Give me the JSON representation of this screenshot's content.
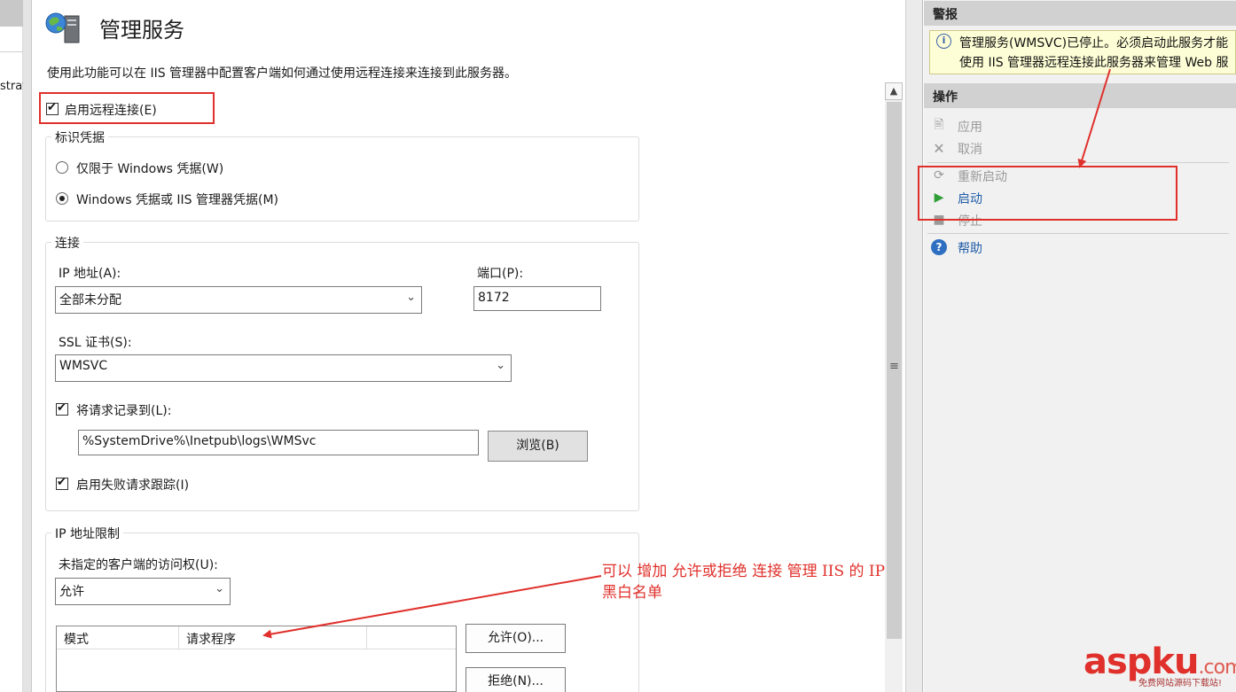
{
  "left_strip": {
    "text": "strat"
  },
  "page": {
    "title": "管理服务",
    "description": "使用此功能可以在 IIS 管理器中配置客户端如何通过使用远程连接来连接到此服务器。"
  },
  "remote": {
    "enable_label": "启用远程连接(E)",
    "checked": true
  },
  "identity": {
    "group_title": "标识凭据",
    "option_windows_only": "仅限于 Windows 凭据(W)",
    "option_windows_or_iis": "Windows 凭据或 IIS 管理器凭据(M)",
    "selected": "option_windows_or_iis"
  },
  "connection": {
    "group_title": "连接",
    "ip_label": "IP 地址(A):",
    "ip_value": "全部未分配",
    "port_label": "端口(P):",
    "port_value": "8172",
    "ssl_label": "SSL 证书(S):",
    "ssl_value": "WMSVC",
    "log_label": "将请求记录到(L):",
    "log_path": "%SystemDrive%\\Inetpub\\logs\\WMSvc",
    "browse_label": "浏览(B)",
    "failed_trace_label": "启用失败请求跟踪(I)"
  },
  "ip_restriction": {
    "group_title": "IP 地址限制",
    "access_label": "未指定的客户端的访问权(U):",
    "access_value": "允许",
    "columns": [
      "模式",
      "请求程序"
    ],
    "allow_button": "允许(O)...",
    "deny_button": "拒绝(N)..."
  },
  "alerts": {
    "header": "警报",
    "message": "管理服务(WMSVC)已停止。必须启动此服务才能使用 IIS 管理器远程连接此服务器来管理 Web 服务器。"
  },
  "actions": {
    "header": "操作",
    "apply": "应用",
    "cancel": "取消",
    "restart": "重新启动",
    "start": "启动",
    "stop": "停止",
    "help": "帮助"
  },
  "annotation": {
    "line1": "可以 增加 允许或拒绝 连接 管理 IIS 的 IP",
    "line2": "黑白名单"
  },
  "watermark": {
    "brand": "aspku",
    "domain": ".com",
    "tagline": "免费网站源码下载站!"
  },
  "colors": {
    "highlight": "#e0302b",
    "link": "#1f5ca8",
    "alert_bg": "#fefed6",
    "panel_header": "#d1d1d1"
  },
  "icons": {
    "title": "server-globe-icon",
    "alert": "info-icon",
    "apply": "apply-icon",
    "cancel": "cancel-icon",
    "restart": "restart-icon",
    "start": "play-icon",
    "stop": "stop-icon",
    "help": "help-icon"
  }
}
